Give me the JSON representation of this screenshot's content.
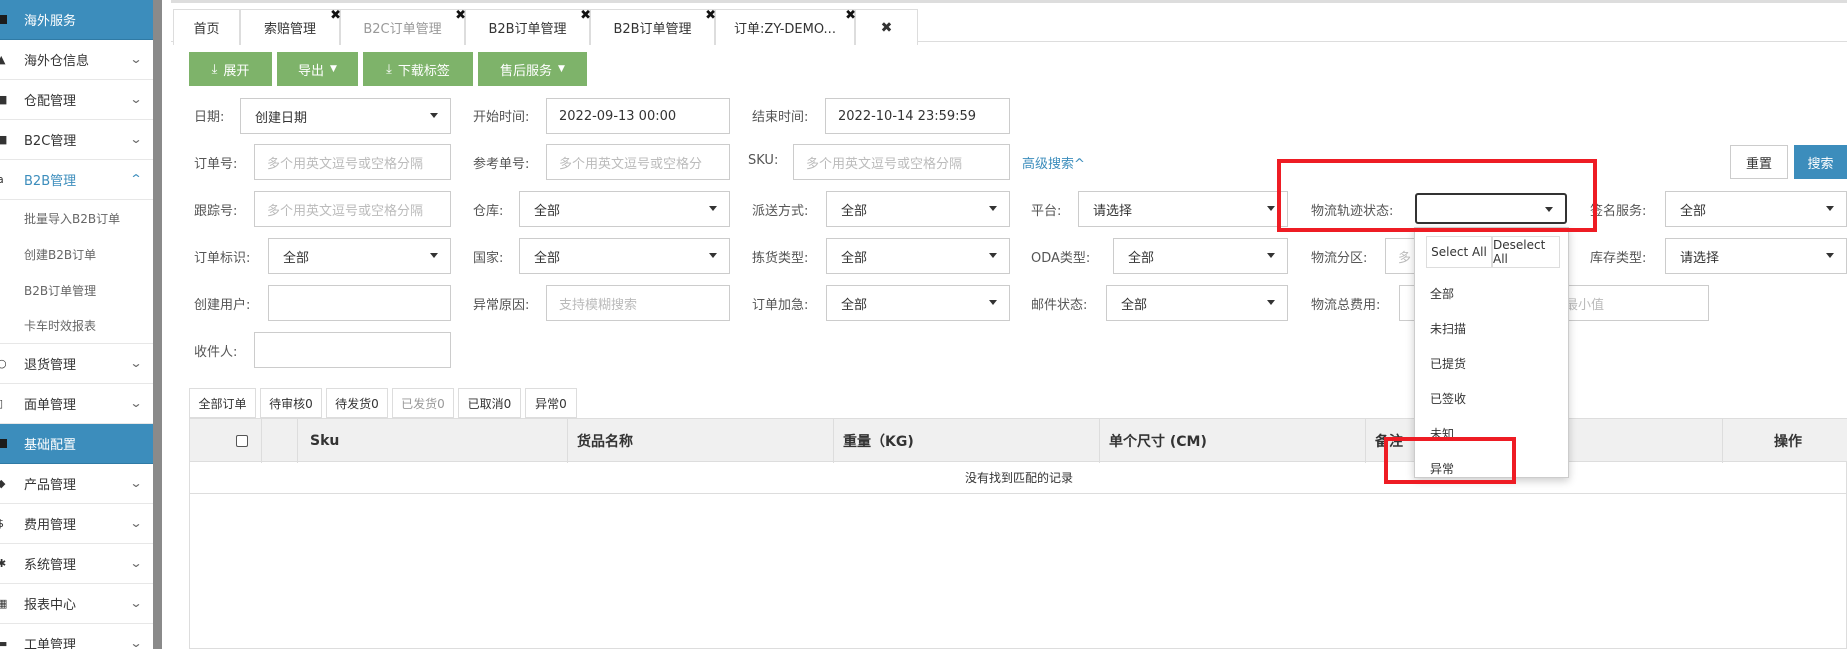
{
  "sidebar": {
    "sections": [
      {
        "label": "海外服务"
      },
      {
        "label": "基础配置"
      }
    ],
    "group1": [
      {
        "label": "海外仓信息",
        "icon": "home-icon"
      },
      {
        "label": "仓配管理",
        "icon": "grid-icon"
      },
      {
        "label": "B2C管理",
        "icon": "truck-icon"
      },
      {
        "label": "B2B管理",
        "icon": "amazon-icon"
      }
    ],
    "b2b_sub": [
      "批量导入B2B订单",
      "创建B2B订单",
      "B2B订单管理",
      "卡车时效报表"
    ],
    "group2": [
      {
        "label": "退货管理",
        "icon": "refresh-icon"
      },
      {
        "label": "面单管理",
        "icon": "file-icon"
      }
    ],
    "group3": [
      {
        "label": "产品管理",
        "icon": "tag-icon"
      },
      {
        "label": "费用管理",
        "icon": "dollar-icon"
      },
      {
        "label": "系统管理",
        "icon": "gear-icon"
      },
      {
        "label": "报表中心",
        "icon": "table-icon"
      },
      {
        "label": "工单管理",
        "icon": "ticket-icon"
      }
    ]
  },
  "tabs": [
    "首页",
    "索赔管理",
    "B2C订单管理",
    "B2B订单管理",
    "B2B订单管理",
    "订单:ZY-DEMO..."
  ],
  "toolbar": {
    "expand": "展开",
    "export": "导出",
    "download_label": "下载标签",
    "after_sales": "售后服务"
  },
  "filters": {
    "date_label": "日期:",
    "date_type": "创建日期",
    "start_label": "开始时间:",
    "start_value": "2022-09-13 00:00",
    "end_label": "结束时间:",
    "end_value": "2022-10-14 23:59:59",
    "order_no_label": "订单号:",
    "order_no_ph": "多个用英文逗号或空格分隔",
    "ref_no_label": "参考单号:",
    "ref_no_ph": "多个用英文逗号或空格分",
    "sku_label": "SKU:",
    "sku_ph": "多个用英文逗号或空格分隔",
    "advanced": "高级搜索^",
    "tracking_label": "跟踪号:",
    "tracking_ph": "多个用英文逗号或空格分隔",
    "warehouse_label": "仓库:",
    "warehouse_value": "全部",
    "delivery_label": "派送方式:",
    "delivery_value": "全部",
    "platform_label": "平台:",
    "platform_value": "请选择",
    "logistics_status_label": "物流轨迹状态:",
    "logistics_status_value": "",
    "sign_label": "签名服务:",
    "sign_value": "全部",
    "order_flag_label": "订单标识:",
    "order_flag_value": "全部",
    "country_label": "国家:",
    "country_value": "全部",
    "pick_label": "拣货类型:",
    "pick_value": "全部",
    "oda_label": "ODA类型:",
    "oda_value": "全部",
    "zone_label": "物流分区:",
    "zone_value": "多",
    "stock_label": "库存类型:",
    "stock_value": "请选择",
    "creator_label": "创建用户:",
    "creator_value": "",
    "exception_label": "异常原因:",
    "exception_ph": "支持模糊搜索",
    "urgent_label": "订单加急:",
    "urgent_value": "全部",
    "mail_label": "邮件状态:",
    "mail_value": "全部",
    "fee_label": "物流总费用:",
    "fee_min_ph": "最小值",
    "receiver_label": "收件人:",
    "receiver_value": ""
  },
  "buttons": {
    "reset": "重置",
    "search": "搜索"
  },
  "status_tabs": [
    "全部订单",
    "待审核0",
    "待发货0",
    "已发货0",
    "已取消0",
    "异常0"
  ],
  "table": {
    "headers": [
      "Sku",
      "货品名称",
      "重量（KG)",
      "单个尺寸 (CM)",
      "备注",
      "操作"
    ],
    "empty_text": "没有找到匹配的记录"
  },
  "dropdown": {
    "select_all": "Select All",
    "deselect_all": "Deselect All",
    "options": [
      "全部",
      "未扫描",
      "已提货",
      "已签收",
      "未知",
      "异常"
    ]
  },
  "colors": {
    "sidebar_section": "#3c8dbc",
    "toolbar_button": "#7eb36a",
    "search_button": "#3c8dbc",
    "annotation": "#ee1c24"
  }
}
